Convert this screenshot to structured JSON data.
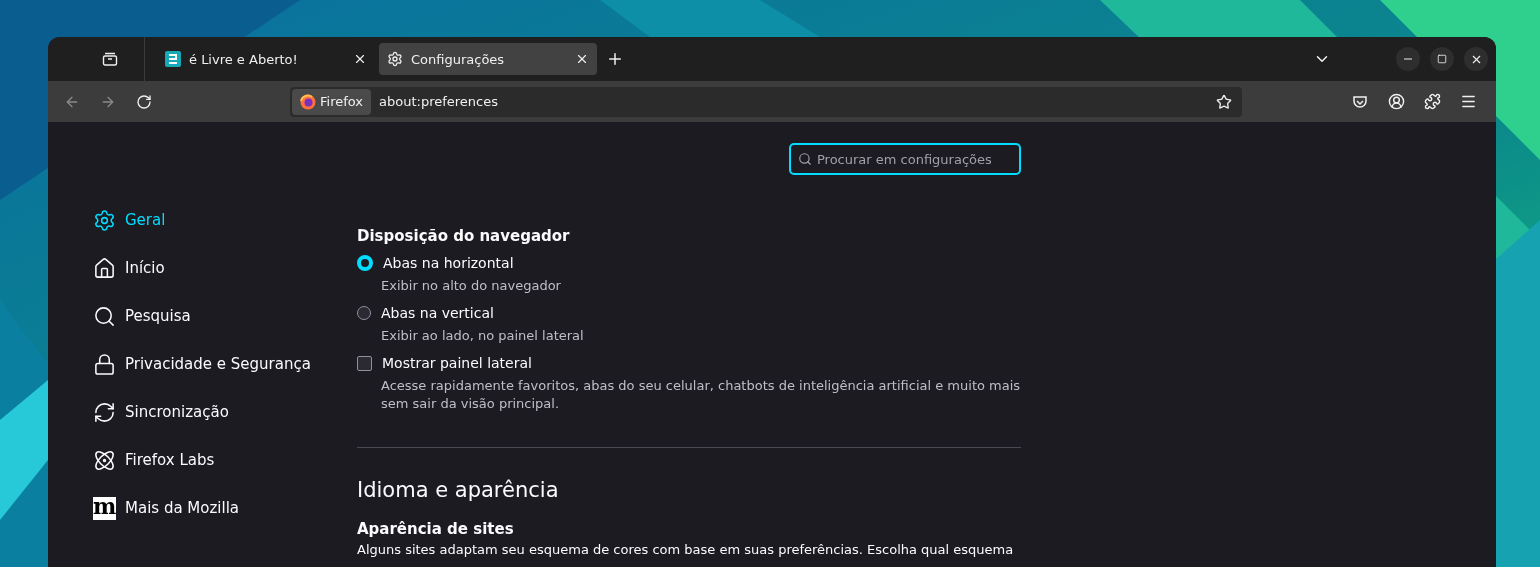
{
  "tabs": [
    {
      "title": "é Livre e Aberto!",
      "selected": false,
      "kind": "site"
    },
    {
      "title": "Configurações",
      "selected": true,
      "kind": "settings"
    }
  ],
  "address_bar": {
    "identity": "Firefox",
    "url": "about:preferences"
  },
  "navigation": {
    "back_disabled": true,
    "forward_disabled": true
  },
  "search": {
    "placeholder": "Procurar em configurações",
    "focused": true
  },
  "sidebar": {
    "items": [
      {
        "label": "Geral",
        "selected": true,
        "kind": "general"
      },
      {
        "label": "Início",
        "selected": false,
        "kind": "home"
      },
      {
        "label": "Pesquisa",
        "selected": false,
        "kind": "search"
      },
      {
        "label": "Privacidade e Segurança",
        "selected": false,
        "kind": "privacy"
      },
      {
        "label": "Sincronização",
        "selected": false,
        "kind": "sync"
      },
      {
        "label": "Firefox Labs",
        "selected": false,
        "kind": "labs"
      },
      {
        "label": "Mais da Mozilla",
        "selected": false,
        "kind": "mozilla",
        "logo_text": "m"
      }
    ]
  },
  "browser_layout": {
    "heading": "Disposição do navegador",
    "options": [
      {
        "kind": "radio",
        "label": "Abas na horizontal",
        "description": "Exibir no alto do navegador",
        "selected": true
      },
      {
        "kind": "radio",
        "label": "Abas na vertical",
        "description": "Exibir ao lado, no painel lateral",
        "selected": false
      },
      {
        "kind": "checkbox",
        "label": "Mostrar painel lateral",
        "description": "Acesse rapidamente favoritos, abas do seu celular, chatbots de inteligência artificial e muito mais sem sair da visão principal.",
        "checked": false
      }
    ]
  },
  "language_section": {
    "heading": "Idioma e aparência",
    "subheading": "Aparência de sites",
    "text": "Alguns sites adaptam seu esquema de cores com base em suas preferências. Escolha qual esquema"
  }
}
